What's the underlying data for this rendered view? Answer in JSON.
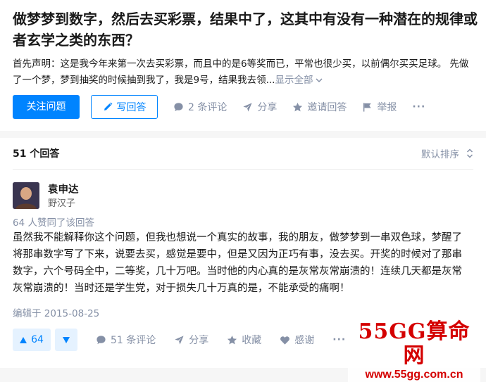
{
  "question": {
    "title": "做梦梦到数字，然后去买彩票，结果中了，这其中有没有一种潜在的规律或者玄学之类的东西？",
    "excerpt": "首先声明：这是我今年来第一次去买彩票，而且中的是6等奖而已，平常也很少买，以前偶尔买买足球。 先做了一个梦，梦到抽奖的时候抽到我了，我是9号，结果我去领...",
    "show_all_label": "显示全部",
    "follow_label": "关注问题",
    "write_answer_label": "写回答",
    "comments_label": "2 条评论",
    "share_label": "分享",
    "invite_label": "邀请回答",
    "report_label": "举报",
    "more_label": "···"
  },
  "answers_header": {
    "count_label": "51 个回答",
    "sort_label": "默认排序"
  },
  "answer": {
    "author_name": "袁申达",
    "author_bio": "野汉子",
    "voters_label": "64 人赞同了该回答",
    "body": "虽然我不能解释你这个问题，但我也想说一个真实的故事，我的朋友，做梦梦到一串双色球，梦醒了将那串数字写了下来，说要去买，感觉是要中，但是又因为正巧有事，没去买。开奖的时候对了那串数字，六个号码全中，二等奖，几十万吧。当时他的内心真的是灰常灰常崩溃的！连续几天都是灰常灰常崩溃的！当时还是学生党，对于损失几十万真的是，不能承受的痛啊！",
    "edited_label": "编辑于 2015-08-25",
    "upvote_count": "64",
    "comments_label": "51 条评论",
    "share_label": "分享",
    "collect_label": "收藏",
    "thanks_label": "感谢",
    "more_label": "···"
  },
  "watermark": {
    "line1": "55GG算命网",
    "line2": "www.55gg.com.cn"
  },
  "colors": {
    "primary": "#0084ff",
    "meta_gray": "#8590a6",
    "watermark_red": "#d40000"
  }
}
